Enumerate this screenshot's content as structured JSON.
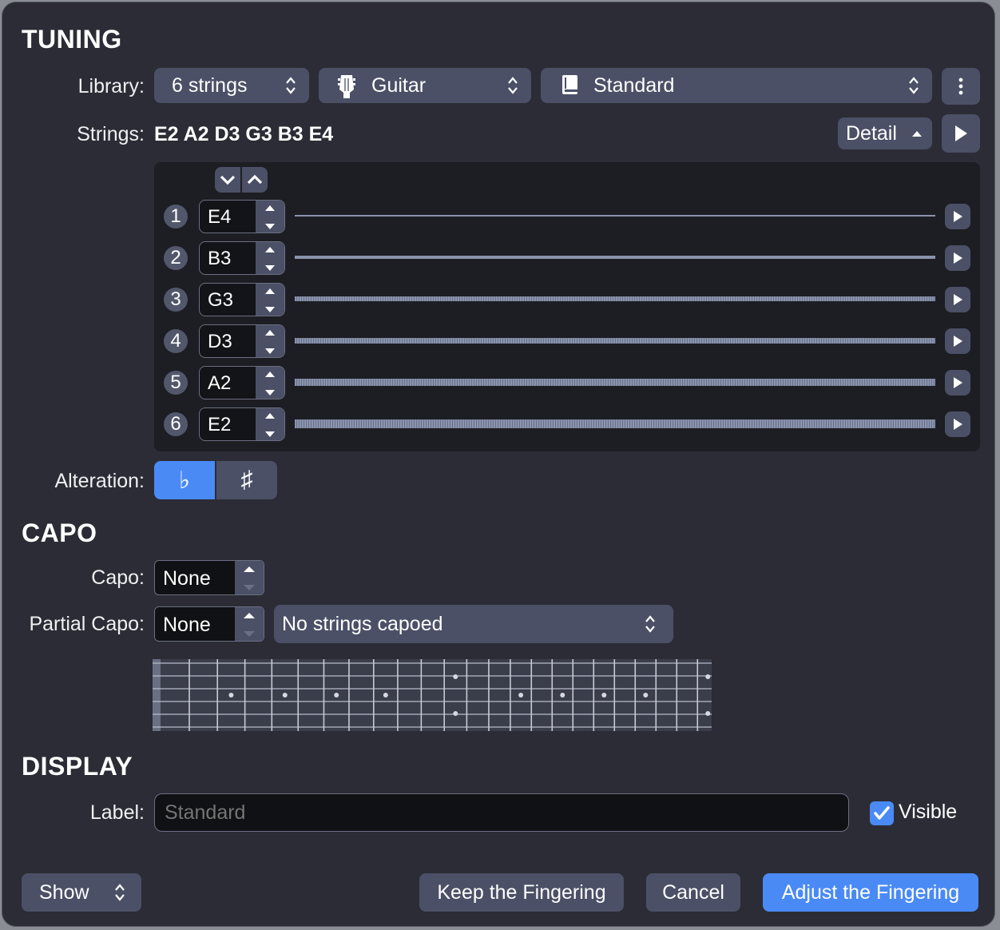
{
  "tuning": {
    "title": "TUNING",
    "library_label": "Library:",
    "strings_count_popup": "6 strings",
    "instrument_popup": "Guitar",
    "tuning_popup": "Standard",
    "strings_label": "Strings:",
    "strings_value": "E2 A2 D3 G3 B3 E4",
    "detail_button": "Detail",
    "strings": [
      {
        "number": "1",
        "note": "E4"
      },
      {
        "number": "2",
        "note": "B3"
      },
      {
        "number": "3",
        "note": "G3"
      },
      {
        "number": "4",
        "note": "D3"
      },
      {
        "number": "5",
        "note": "A2"
      },
      {
        "number": "6",
        "note": "E2"
      }
    ],
    "alteration_label": "Alteration:",
    "alteration_options": [
      "♭",
      "♯"
    ],
    "alteration_selected": "♭"
  },
  "capo": {
    "title": "CAPO",
    "capo_label": "Capo:",
    "capo_value": "None",
    "partial_capo_label": "Partial Capo:",
    "partial_capo_value": "None",
    "partial_strings_popup": "No strings capoed"
  },
  "display": {
    "title": "DISPLAY",
    "label_label": "Label:",
    "label_placeholder": "Standard",
    "visible_label": "Visible",
    "visible_checked": true
  },
  "footer": {
    "show_popup": "Show",
    "keep_button": "Keep the Fingering",
    "cancel_button": "Cancel",
    "adjust_button": "Adjust the Fingering"
  },
  "colors": {
    "window_bg": "#2b2c35",
    "control_bg": "#4b5066",
    "accent": "#4a8af5",
    "field_bg": "#101114"
  },
  "icons": {
    "instrument": "guitar-headstock-icon",
    "tuning": "book-icon",
    "more": "vertical-ellipsis-icon",
    "play": "play-icon",
    "popup": "up-down-chevron-icon"
  }
}
